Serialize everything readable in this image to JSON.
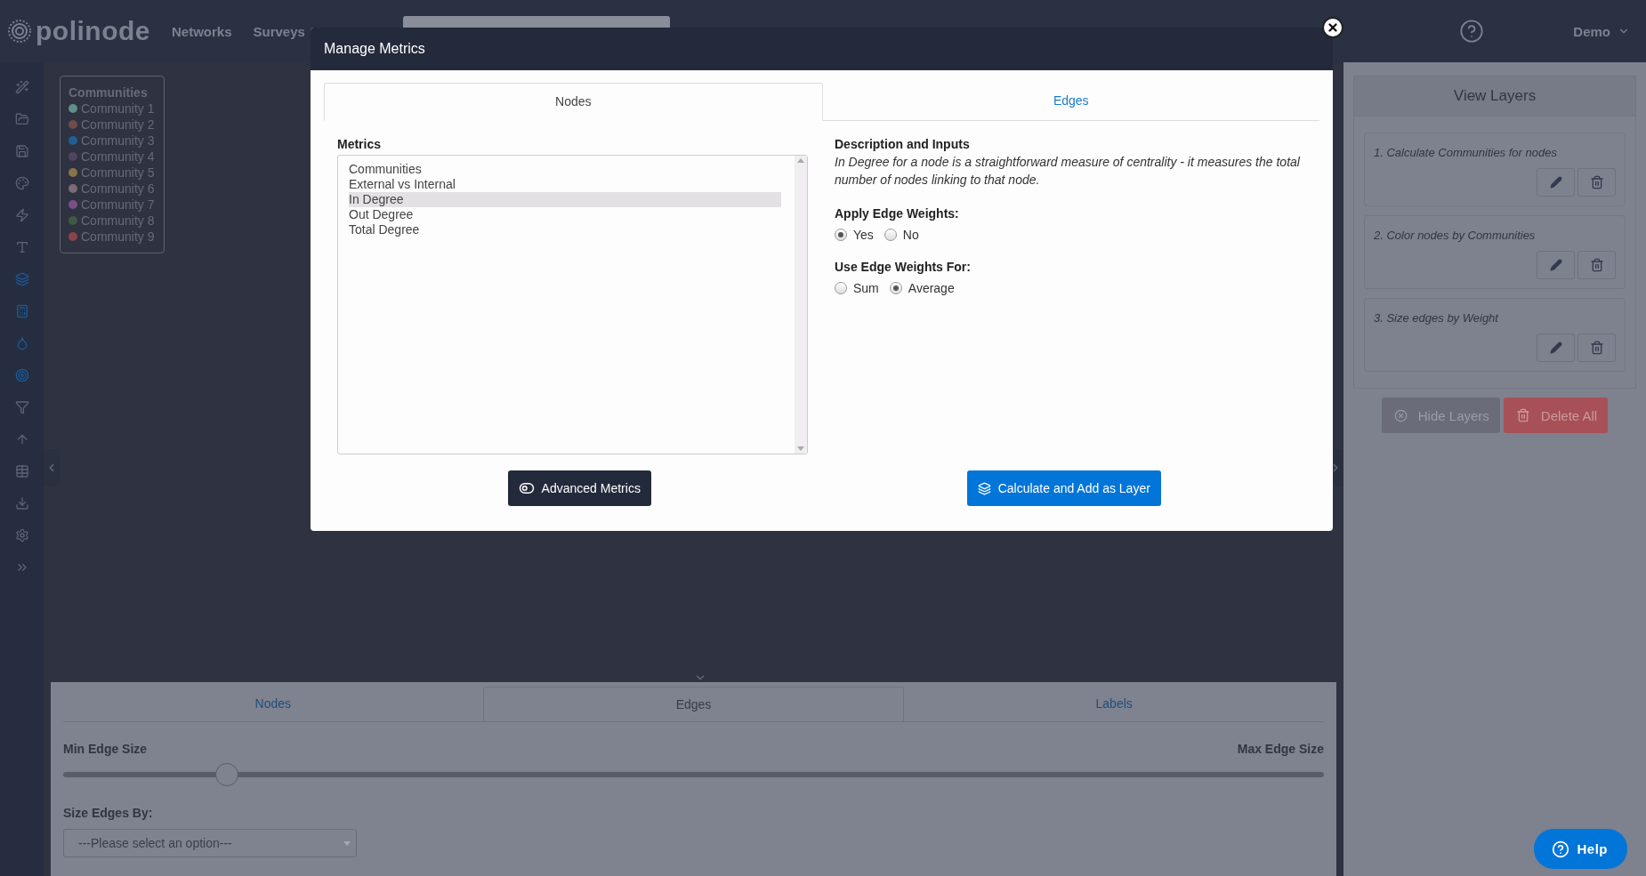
{
  "header": {
    "logo": "polinode",
    "nav": [
      "Networks",
      "Surveys"
    ],
    "user": "Demo"
  },
  "sidebar": {
    "items": [
      {
        "active": false
      },
      {
        "active": false
      },
      {
        "active": false
      },
      {
        "active": false
      },
      {
        "active": false
      },
      {
        "active": false
      },
      {
        "active": true
      },
      {
        "active": true
      },
      {
        "active": true
      },
      {
        "active": true
      },
      {
        "active": false
      },
      {
        "active": false
      },
      {
        "active": false
      },
      {
        "active": false
      },
      {
        "active": false
      },
      {
        "active": false
      }
    ]
  },
  "legend": {
    "title": "Communities",
    "items": [
      {
        "name": "Community 1",
        "color": "#5f8f8a"
      },
      {
        "name": "Community 2",
        "color": "#6e4c48"
      },
      {
        "name": "Community 3",
        "color": "#1f5f93"
      },
      {
        "name": "Community 4",
        "color": "#4e455e"
      },
      {
        "name": "Community 5",
        "color": "#8a7446"
      },
      {
        "name": "Community 6",
        "color": "#7c6a78"
      },
      {
        "name": "Community 7",
        "color": "#7a4f86"
      },
      {
        "name": "Community 8",
        "color": "#3f5a43"
      },
      {
        "name": "Community 9",
        "color": "#8a4449"
      }
    ]
  },
  "modal": {
    "title": "Manage Metrics",
    "tabs": [
      {
        "label": "Nodes",
        "selected": true
      },
      {
        "label": "Edges",
        "selected": false
      }
    ],
    "metrics_label": "Metrics",
    "metrics": [
      {
        "label": "Communities",
        "selected": false
      },
      {
        "label": "External vs Internal",
        "selected": false
      },
      {
        "label": "In Degree",
        "selected": true
      },
      {
        "label": "Out Degree",
        "selected": false
      },
      {
        "label": "Total Degree",
        "selected": false
      }
    ],
    "description_title": "Description and Inputs",
    "description": "In Degree for a node is a straightforward measure of centrality - it measures the total number of nodes linking to that node.",
    "groups": [
      {
        "label": "Apply Edge Weights:",
        "options": [
          {
            "label": "Yes",
            "selected": true
          },
          {
            "label": "No",
            "selected": false
          }
        ]
      },
      {
        "label": "Use Edge Weights For:",
        "options": [
          {
            "label": "Sum",
            "selected": false
          },
          {
            "label": "Average",
            "selected": true
          }
        ]
      }
    ],
    "advanced_button": "Advanced Metrics",
    "calculate_button": "Calculate and Add as Layer"
  },
  "layers_panel": {
    "title": "View Layers",
    "layers": [
      "1. Calculate Communities for nodes",
      "2. Color nodes by Communities",
      "3. Size edges by Weight"
    ],
    "hide_button": "Hide Layers",
    "delete_button": "Delete All"
  },
  "bottom_panel": {
    "tabs": [
      {
        "label": "Nodes",
        "selected": false
      },
      {
        "label": "Edges",
        "selected": true
      },
      {
        "label": "Labels",
        "selected": false
      }
    ],
    "min_label": "Min Edge Size",
    "max_label": "Max Edge Size",
    "slider": {
      "level": 0.13
    },
    "size_by_label": "Size Edges By:",
    "size_by_select": {
      "value": "---Please select an option---"
    }
  },
  "help_button": "Help"
}
